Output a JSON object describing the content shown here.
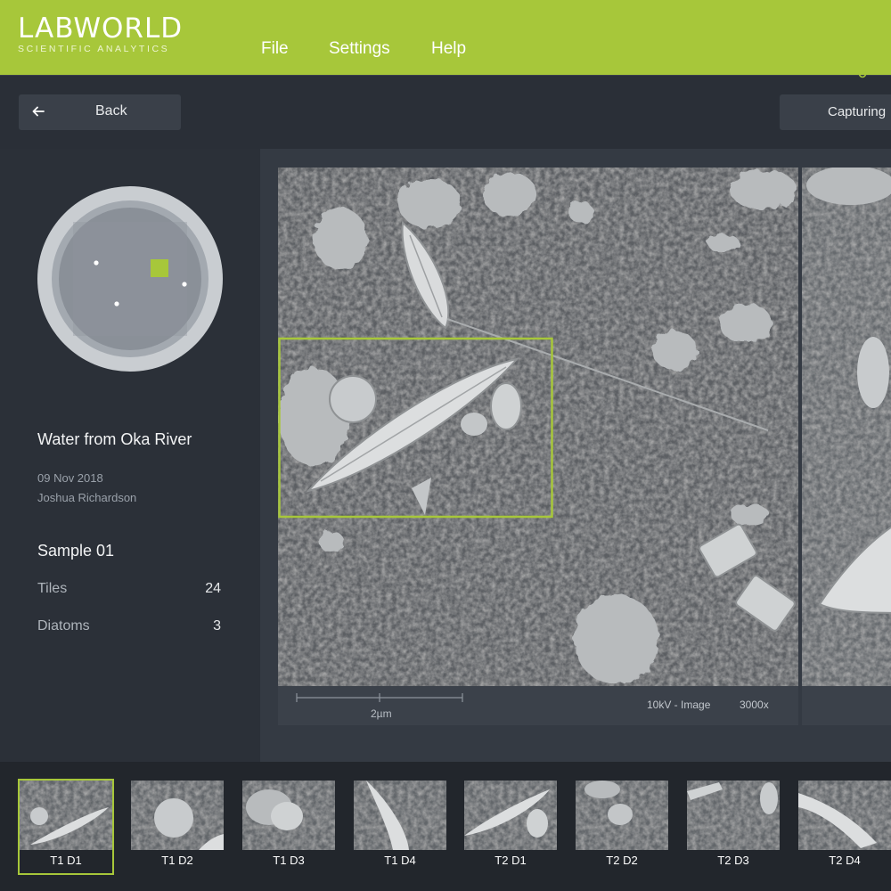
{
  "app": {
    "logo_main": "LABWORLD",
    "logo_sub": "SCIENTIFIC ANALYTICS",
    "accent_color": "#a7c73a"
  },
  "menu": {
    "file": "File",
    "settings": "Settings",
    "help": "Help"
  },
  "toolbar": {
    "back_label": "Back",
    "back_icon": "arrow-left-icon",
    "capture_label": "Capturing"
  },
  "sample": {
    "title": "Water from Oka River",
    "date": "09 Nov 2018",
    "author": "Joshua Richardson",
    "name": "Sample 01",
    "stats": [
      {
        "label": "Tiles",
        "value": "24"
      },
      {
        "label": "Diatoms",
        "value": "3"
      }
    ]
  },
  "viewer": {
    "scale_label": "2µm",
    "mode_label": "10kV - Image",
    "zoom_label": "3000x"
  },
  "thumbnails": [
    {
      "label": "T1 D1",
      "selected": true
    },
    {
      "label": "T1 D2",
      "selected": false
    },
    {
      "label": "T1 D3",
      "selected": false
    },
    {
      "label": "T1 D4",
      "selected": false
    },
    {
      "label": "T2 D1",
      "selected": false
    },
    {
      "label": "T2 D2",
      "selected": false
    },
    {
      "label": "T2 D3",
      "selected": false
    },
    {
      "label": "T2 D4",
      "selected": false
    }
  ]
}
